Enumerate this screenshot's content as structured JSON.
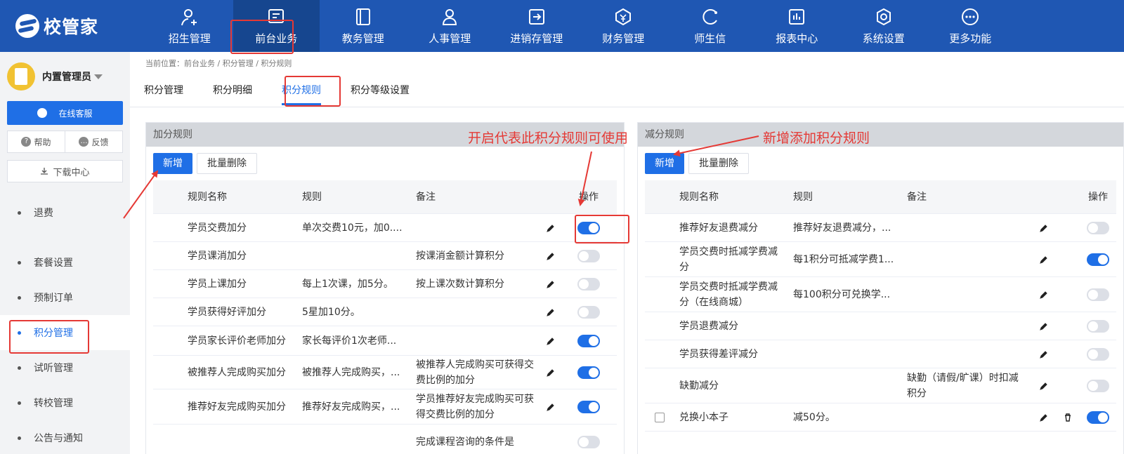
{
  "app": {
    "logo": "校管家"
  },
  "nav": [
    {
      "label": "招生管理",
      "icon": "add-user-icon"
    },
    {
      "label": "前台业务",
      "icon": "front-desk-icon",
      "active": true
    },
    {
      "label": "教务管理",
      "icon": "book-icon"
    },
    {
      "label": "人事管理",
      "icon": "person-icon"
    },
    {
      "label": "进销存管理",
      "icon": "inventory-icon"
    },
    {
      "label": "财务管理",
      "icon": "finance-icon"
    },
    {
      "label": "师生信",
      "icon": "message-icon"
    },
    {
      "label": "报表中心",
      "icon": "report-icon"
    },
    {
      "label": "系统设置",
      "icon": "settings-icon"
    },
    {
      "label": "更多功能",
      "icon": "more-icon"
    }
  ],
  "sidebar": {
    "user": "内置管理员",
    "service_btn": "在线客服",
    "help": "帮助",
    "feedback": "反馈",
    "download": "下载中心",
    "menu": [
      "退费",
      "套餐设置",
      "预制订单",
      "积分管理",
      "试听管理",
      "转校管理",
      "公告与通知"
    ]
  },
  "breadcrumb": "当前位置：前台业务 / 积分管理 / 积分规则",
  "tabs": [
    "积分管理",
    "积分明细",
    "积分规则",
    "积分等级设置"
  ],
  "left_panel": {
    "title": "加分规则",
    "add_btn": "新增",
    "batch_delete_btn": "批量删除",
    "columns": {
      "name": "规则名称",
      "rule": "规则",
      "note": "备注",
      "ops": "操作"
    },
    "rows": [
      {
        "name": "学员交费加分",
        "rule": "单次交费10元，加0....",
        "note": "",
        "on": true
      },
      {
        "name": "学员课消加分",
        "rule": "",
        "note": "按课消金额计算积分",
        "on": false
      },
      {
        "name": "学员上课加分",
        "rule": "每上1次课，加5分。",
        "note": "按上课次数计算积分",
        "on": false
      },
      {
        "name": "学员获得好评加分",
        "rule": "5星加10分。",
        "note": "",
        "on": false
      },
      {
        "name": "学员家长评价老师加分",
        "rule": "家长每评价1次老师...",
        "note": "",
        "on": true
      },
      {
        "name": "被推荐人完成购买加分",
        "rule": "被推荐人完成购买，...",
        "note": "被推荐人完成购买可获得交费比例的加分",
        "on": true
      },
      {
        "name": "推荐好友完成购买加分",
        "rule": "推荐好友完成购买，...",
        "note": "学员推荐好友完成购买可获得交费比例的加分",
        "on": true
      },
      {
        "name": "",
        "rule": "",
        "note": "完成课程咨询的条件是",
        "on": false
      }
    ]
  },
  "right_panel": {
    "title": "减分规则",
    "add_btn": "新增",
    "batch_delete_btn": "批量删除",
    "columns": {
      "name": "规则名称",
      "rule": "规则",
      "note": "备注",
      "ops": "操作"
    },
    "rows": [
      {
        "name": "推荐好友退费减分",
        "rule": "推荐好友退费减分，...",
        "note": "",
        "on": false
      },
      {
        "name": "学员交费时抵减学费减分",
        "rule": "每1积分可抵减学费1...",
        "note": "",
        "on": true
      },
      {
        "name": "学员交费时抵减学费减分（在线商城）",
        "rule": "每100积分可兑换学...",
        "note": "",
        "on": false
      },
      {
        "name": "学员退费减分",
        "rule": "",
        "note": "",
        "on": false
      },
      {
        "name": "学员获得差评减分",
        "rule": "",
        "note": "",
        "on": false
      },
      {
        "name": "缺勤减分",
        "rule": "",
        "note": "缺勤（请假/旷课）时扣减积分",
        "on": false
      },
      {
        "name": "兑换小本子",
        "rule": "减50分。",
        "note": "",
        "on": true,
        "checkbox": true,
        "deletable": true
      }
    ]
  },
  "annotations": {
    "enable_note": "开启代表此积分规则可使用",
    "add_note": "新增添加积分规则",
    "color": "#e53935"
  }
}
